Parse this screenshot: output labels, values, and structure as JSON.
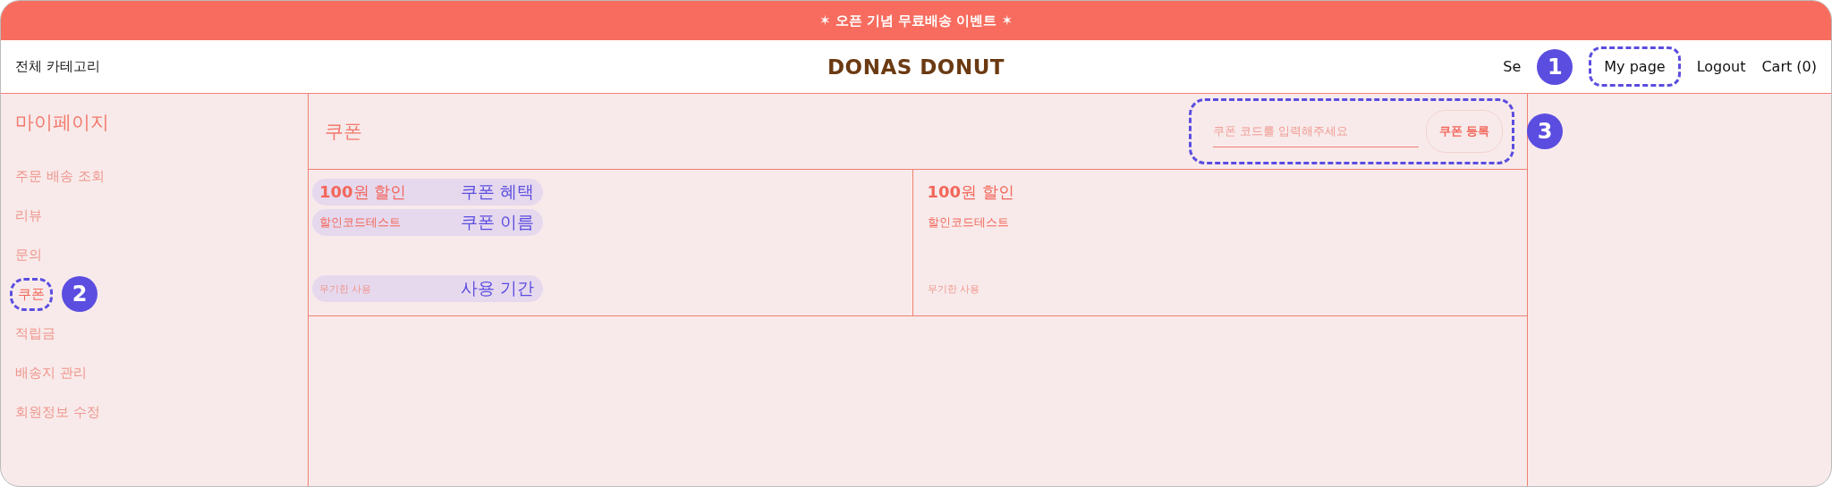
{
  "banner": {
    "text": "✶ 오픈 기념 무료배송 이벤트 ✶"
  },
  "header": {
    "category": "전체 카테고리",
    "logo": "DONAS DONUT",
    "nav": [
      {
        "label": "Se",
        "callout": "1"
      },
      {
        "label": "My page",
        "highlighted": true
      },
      {
        "label": "Logout"
      },
      {
        "label": "Cart (0)"
      }
    ]
  },
  "sidebar": {
    "title": "마이페이지",
    "items": [
      {
        "label": "주문 배송 조회",
        "selected": false
      },
      {
        "label": "리뷰",
        "selected": false
      },
      {
        "label": "문의",
        "selected": false
      },
      {
        "label": "쿠폰",
        "selected": true,
        "callout": "2"
      },
      {
        "label": "적립금",
        "selected": false
      },
      {
        "label": "배송지 관리",
        "selected": false
      },
      {
        "label": "회원정보 수정",
        "selected": false
      }
    ]
  },
  "coupon_panel": {
    "title": "쿠폰",
    "form": {
      "placeholder": "쿠폰 코드를 입력해주세요",
      "button": "쿠폰 등록",
      "callout": "3"
    },
    "coupons": [
      {
        "benefit": "**100**원 할인",
        "name": "할인코드테스트",
        "period": "무기한 사용",
        "notes": {
          "benefit": "쿠폰 혜택",
          "name": "쿠폰 이름",
          "period": "사용 기간"
        }
      },
      {
        "benefit": "**100**원 할인",
        "name": "할인코드테스트",
        "period": "무기한 사용"
      }
    ]
  }
}
